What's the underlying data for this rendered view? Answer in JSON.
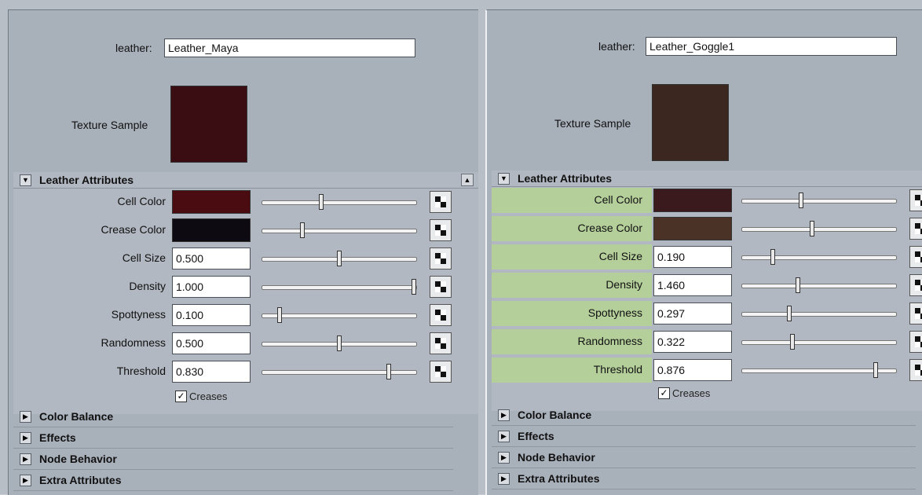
{
  "left": {
    "name_label": "leather:",
    "name_value": "Leather_Maya",
    "texture_label": "Texture Sample",
    "texture_color": "#3a0d12",
    "section_title": "Leather Attributes",
    "rows": [
      {
        "label": "Cell Color",
        "kind": "color",
        "color": "#4a0c10",
        "slider": 0.38
      },
      {
        "label": "Crease Color",
        "kind": "color",
        "color": "#0d0a12",
        "slider": 0.25
      },
      {
        "label": "Cell Size",
        "kind": "number",
        "value": "0.500",
        "slider": 0.5
      },
      {
        "label": "Density",
        "kind": "number",
        "value": "1.000",
        "slider": 1.0
      },
      {
        "label": "Spottyness",
        "kind": "number",
        "value": "0.100",
        "slider": 0.1
      },
      {
        "label": "Randomness",
        "kind": "number",
        "value": "0.500",
        "slider": 0.5
      },
      {
        "label": "Threshold",
        "kind": "number",
        "value": "0.830",
        "slider": 0.83
      }
    ],
    "creases_label": "Creases",
    "creases_checked": true,
    "collapsed": [
      "Color Balance",
      "Effects",
      "Node Behavior",
      "Extra Attributes"
    ]
  },
  "right": {
    "name_label": "leather:",
    "name_value": "Leather_Goggle1",
    "texture_label": "Texture Sample",
    "texture_color": "#3c2620",
    "section_title": "Leather Attributes",
    "rows": [
      {
        "label": "Cell Color",
        "kind": "color",
        "color": "#3a1a1c",
        "slider": 0.38
      },
      {
        "label": "Crease Color",
        "kind": "color",
        "color": "#4a3226",
        "slider": 0.45
      },
      {
        "label": "Cell Size",
        "kind": "number",
        "value": "0.190",
        "slider": 0.19
      },
      {
        "label": "Density",
        "kind": "number",
        "value": "1.460",
        "slider": 0.36
      },
      {
        "label": "Spottyness",
        "kind": "number",
        "value": "0.297",
        "slider": 0.3
      },
      {
        "label": "Randomness",
        "kind": "number",
        "value": "0.322",
        "slider": 0.32
      },
      {
        "label": "Threshold",
        "kind": "number",
        "value": "0.876",
        "slider": 0.88
      }
    ],
    "creases_label": "Creases",
    "creases_checked": true,
    "collapsed": [
      "Color Balance",
      "Effects",
      "Node Behavior",
      "Extra Attributes"
    ]
  }
}
